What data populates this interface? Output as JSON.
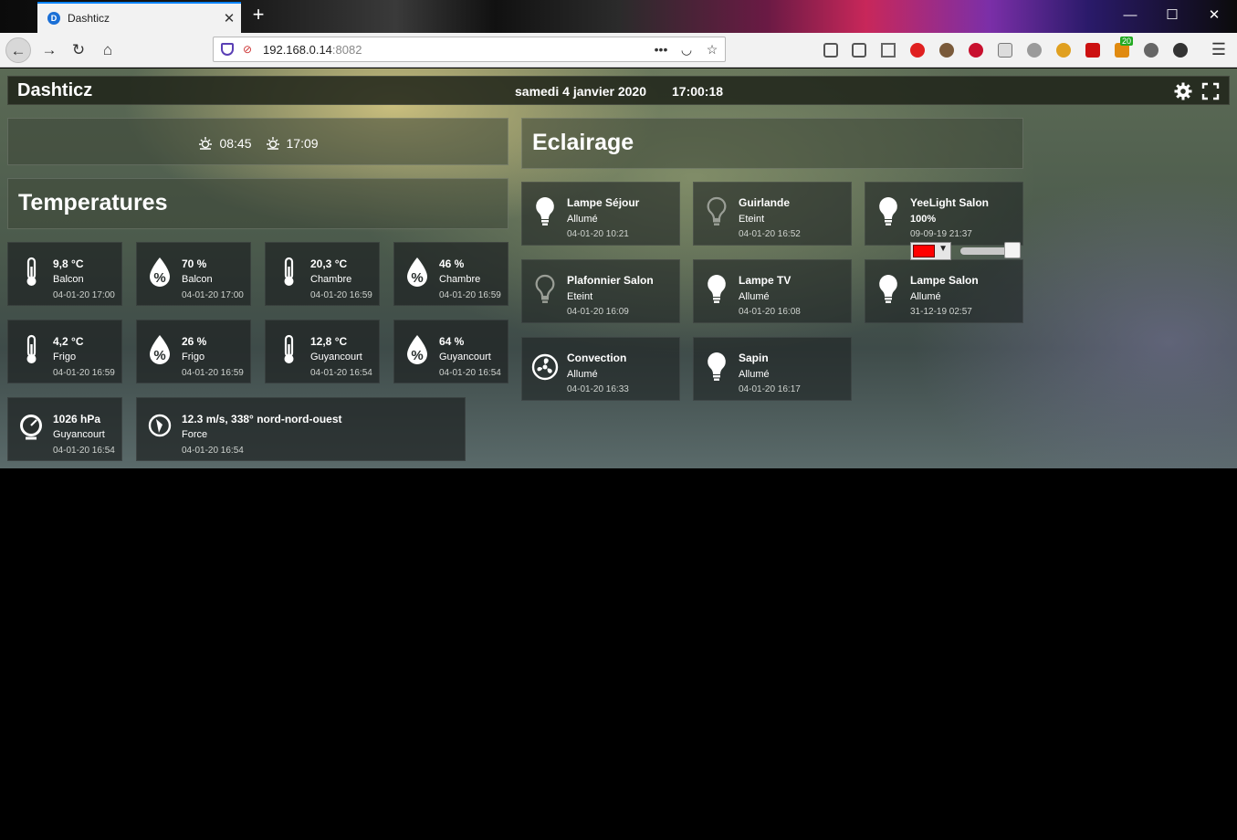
{
  "browser": {
    "tab_title": "Dashticz",
    "new_tab": "+",
    "url_host": "192.168.0.14",
    "url_port": ":8082",
    "url_more": "•••",
    "minimize": "—",
    "maximize": "☐",
    "close": "✕",
    "menu": "☰",
    "extension_badge": "20"
  },
  "header": {
    "title": "Dashticz",
    "date": "samedi 4 janvier 2020",
    "time": "17:00:18"
  },
  "sun": {
    "sunrise": "08:45",
    "sunset": "17:09"
  },
  "sections": {
    "temperatures": "Temperatures",
    "lighting": "Eclairage"
  },
  "sensors": [
    {
      "value": "9,8 °C",
      "name": "Balcon",
      "date": "04-01-20 17:00",
      "icon": "thermometer-icon"
    },
    {
      "value": "70 %",
      "name": "Balcon",
      "date": "04-01-20 17:00",
      "icon": "humidity-icon"
    },
    {
      "value": "20,3 °C",
      "name": "Chambre",
      "date": "04-01-20 16:59",
      "icon": "thermometer-icon"
    },
    {
      "value": "46 %",
      "name": "Chambre",
      "date": "04-01-20 16:59",
      "icon": "humidity-icon"
    },
    {
      "value": "4,2 °C",
      "name": "Frigo",
      "date": "04-01-20 16:59",
      "icon": "thermometer-icon"
    },
    {
      "value": "26 %",
      "name": "Frigo",
      "date": "04-01-20 16:59",
      "icon": "humidity-icon"
    },
    {
      "value": "12,8 °C",
      "name": "Guyancourt",
      "date": "04-01-20 16:54",
      "icon": "thermometer-icon"
    },
    {
      "value": "64 %",
      "name": "Guyancourt",
      "date": "04-01-20 16:54",
      "icon": "humidity-icon"
    },
    {
      "value": "1026 hPa",
      "name": "Guyancourt",
      "date": "04-01-20 16:54",
      "icon": "barometer-icon"
    },
    {
      "value": "12.3 m/s, 338° nord-nord-ouest",
      "name": "Force",
      "date": "04-01-20 16:54",
      "icon": "wind-icon"
    }
  ],
  "lights": [
    {
      "name": "Lampe Séjour",
      "state": "Allumé",
      "date": "04-01-20 10:21",
      "on": true
    },
    {
      "name": "Guirlande",
      "state": "Eteint",
      "date": "04-01-20 16:52",
      "on": false
    },
    {
      "name": "YeeLight Salon",
      "state": "100%",
      "date": "09-09-19 21:37",
      "on": true,
      "color": "#ff0000",
      "level": 1.0
    },
    {
      "name": "Plafonnier Salon",
      "state": "Eteint",
      "date": "04-01-20 16:09",
      "on": false
    },
    {
      "name": "Lampe TV",
      "state": "Allumé",
      "date": "04-01-20 16:08",
      "on": true
    },
    {
      "name": "Lampe Salon",
      "state": "Allumé",
      "date": "31-12-19 02:57",
      "on": true
    },
    {
      "name": "Convection",
      "state": "Allumé",
      "date": "04-01-20 16:33",
      "on": true
    },
    {
      "name": "Sapin",
      "state": "Allumé",
      "date": "04-01-20 16:17",
      "on": true
    }
  ]
}
